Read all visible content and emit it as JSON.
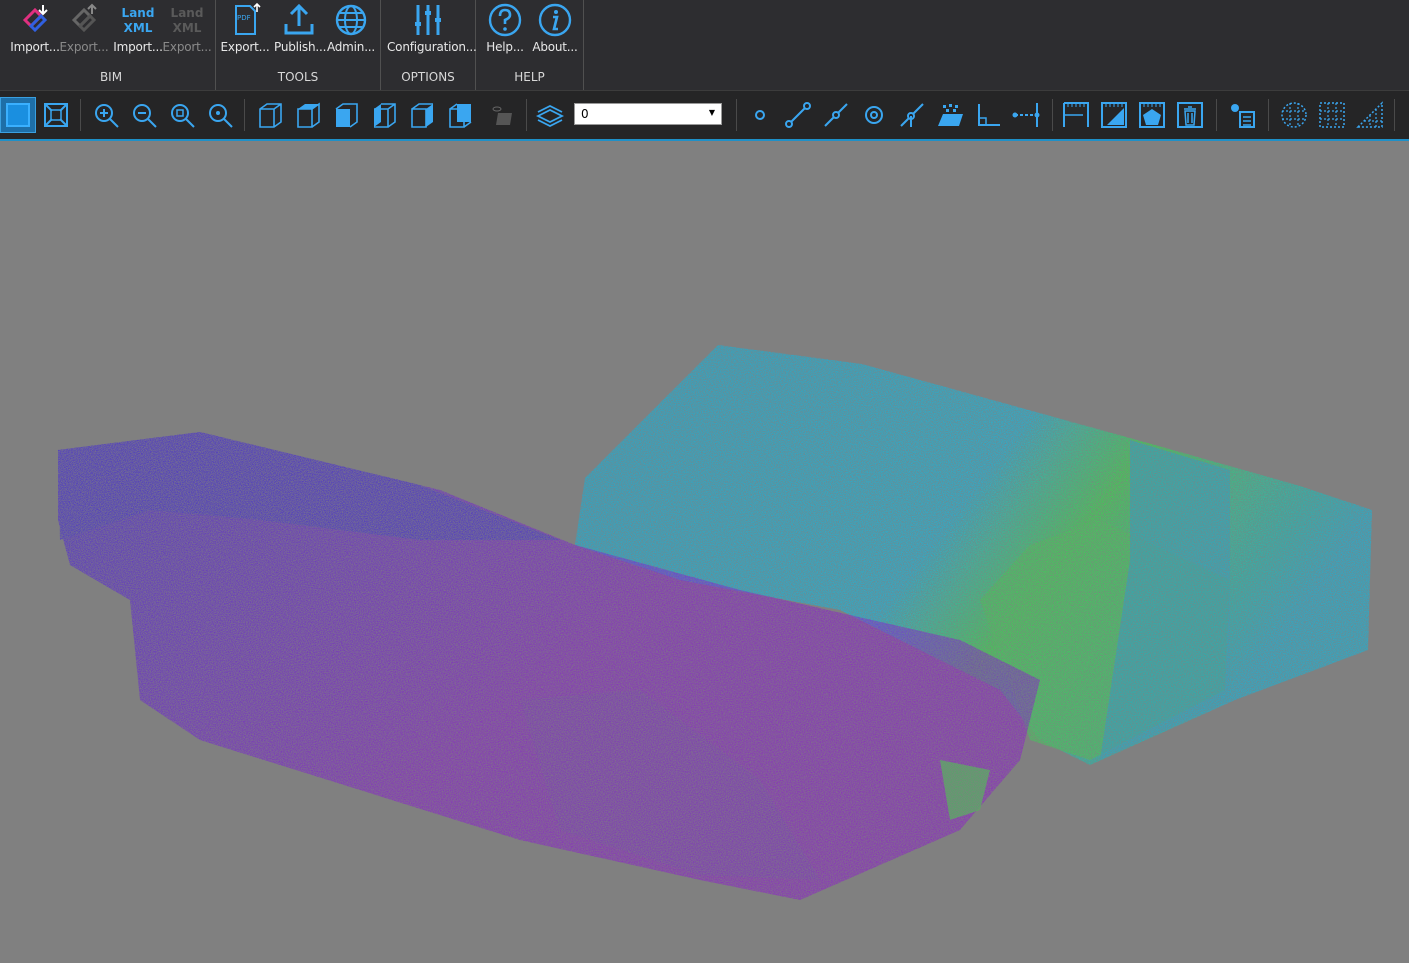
{
  "ribbon": {
    "groups": [
      {
        "label": "BIM",
        "buttons": [
          {
            "label": "Import...",
            "icon": "ifc-import-icon",
            "enabled": true
          },
          {
            "label": "Export...",
            "icon": "ifc-export-icon",
            "enabled": false
          },
          {
            "label": "Import...",
            "icon": "landxml-import-icon",
            "enabled": true,
            "icon_text": [
              "Land",
              "XML"
            ]
          },
          {
            "label": "Export...",
            "icon": "landxml-export-icon",
            "enabled": false,
            "icon_text": [
              "Land",
              "XML"
            ]
          }
        ]
      },
      {
        "label": "TOOLS",
        "buttons": [
          {
            "label": "Export...",
            "icon": "pdf-export-icon",
            "enabled": true,
            "icon_text": [
              "PDF"
            ]
          },
          {
            "label": "Publish...",
            "icon": "upload-icon",
            "enabled": true
          },
          {
            "label": "Admin...",
            "icon": "globe-icon",
            "enabled": true
          }
        ]
      },
      {
        "label": "OPTIONS",
        "buttons": [
          {
            "label": "Configuration...",
            "icon": "sliders-icon",
            "enabled": true
          }
        ]
      },
      {
        "label": "HELP",
        "buttons": [
          {
            "label": "Help...",
            "icon": "help-icon",
            "enabled": true
          },
          {
            "label": "About...",
            "icon": "info-icon",
            "enabled": true
          }
        ]
      }
    ]
  },
  "toolbar": {
    "layer_value": "0",
    "accent": "#1e9ee0",
    "icons": [
      "select-window-icon",
      "zoom-extents-icon",
      "zoom-in-icon",
      "zoom-out-icon",
      "zoom-window-icon",
      "zoom-selection-icon",
      "view-iso-icon",
      "view-top-icon",
      "view-front-icon",
      "view-left-icon",
      "view-right-icon",
      "view-back-icon",
      "hide-icon",
      "layers-icon",
      "point-icon",
      "line-icon",
      "polyline-icon",
      "circle-icon",
      "snap-icon",
      "contour-icon",
      "angle-icon",
      "dimension-icon",
      "section-icon",
      "section-fill-icon",
      "section-shape-icon",
      "section-delete-icon",
      "point-list-icon",
      "grid-dots-icon",
      "grid-icon",
      "grid-slope-icon"
    ]
  },
  "viewport": {
    "background": "#808080",
    "colors": [
      "#3b1ee0",
      "#8a10d8",
      "#00c8f0",
      "#20f040"
    ]
  }
}
